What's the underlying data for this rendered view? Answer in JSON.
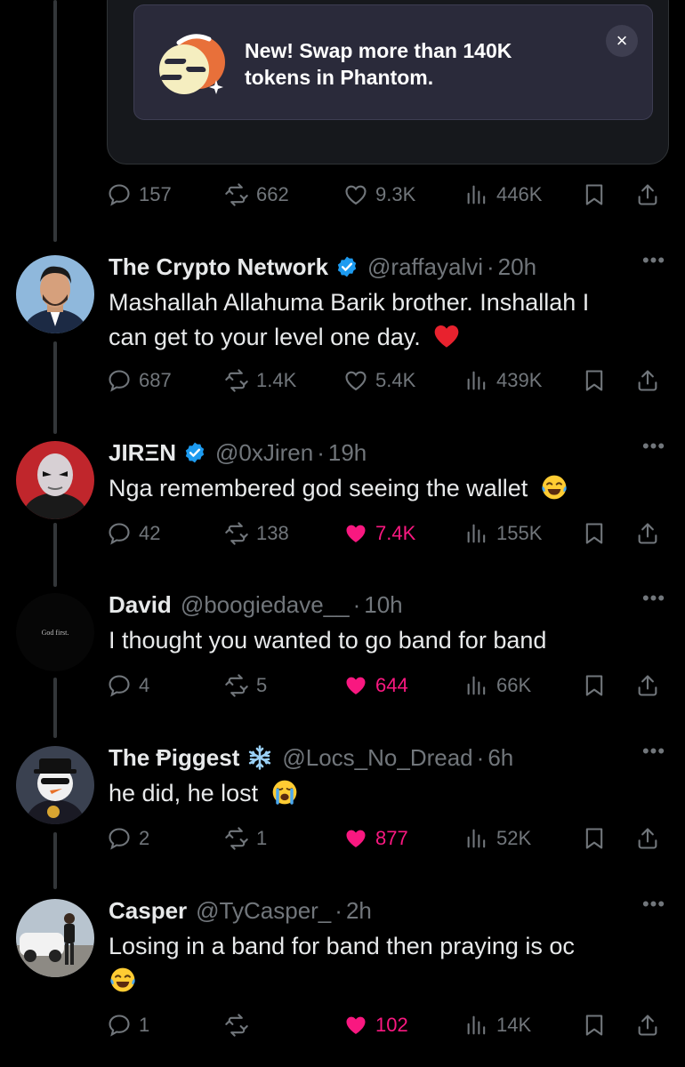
{
  "promo": {
    "line1": "New! Swap more than 140K",
    "line2": "tokens in Phantom.",
    "close_glyph": "×"
  },
  "main_actions": {
    "replies": "157",
    "reposts": "662",
    "likes": "9.3K",
    "views": "446K",
    "liked": false
  },
  "replies": [
    {
      "name": "The Crypto Network",
      "verified": true,
      "handle": "@raffayalvi",
      "time": "20h",
      "text_line1": "Mashallah Allahuma Barik brother. Inshallah I",
      "text_line2": "can get to your level one day.",
      "emoji": "red-heart",
      "replies": "687",
      "reposts": "1.4K",
      "likes": "5.4K",
      "views": "439K",
      "liked": false
    },
    {
      "name": "JIRΞN",
      "verified": true,
      "handle": "@0xJiren",
      "time": "19h",
      "text_line1": "Nga remembered god seeing the wallet",
      "emoji": "tears-of-joy",
      "replies": "42",
      "reposts": "138",
      "likes": "7.4K",
      "views": "155K",
      "liked": true
    },
    {
      "name": "David",
      "verified": false,
      "handle": "@boogiedave__",
      "time": "10h",
      "avatar_text": "God first.",
      "text_line1": "I thought you wanted to go band for band",
      "replies": "4",
      "reposts": "5",
      "likes": "644",
      "views": "66K",
      "liked": true
    },
    {
      "name": "The Ᵽiggest",
      "verified": false,
      "name_emoji": "snowflake",
      "handle": "@Locs_No_Dread",
      "time": "6h",
      "text_line1": "he did, he lost",
      "emoji": "crying",
      "replies": "2",
      "reposts": "1",
      "likes": "877",
      "views": "52K",
      "liked": true
    },
    {
      "name": "Casper",
      "verified": false,
      "handle": "@TyCasper_",
      "time": "2h",
      "text_line1": "Losing in a band for band then praying is oc",
      "emoji": "tears-of-joy",
      "replies": "1",
      "reposts": "",
      "likes": "102",
      "views": "14K",
      "liked": true
    }
  ],
  "sep": "·",
  "more_glyph": "•••",
  "colors": {
    "like_active": "#f91880",
    "muted": "#71767b",
    "verified": "#1d9bf0"
  }
}
